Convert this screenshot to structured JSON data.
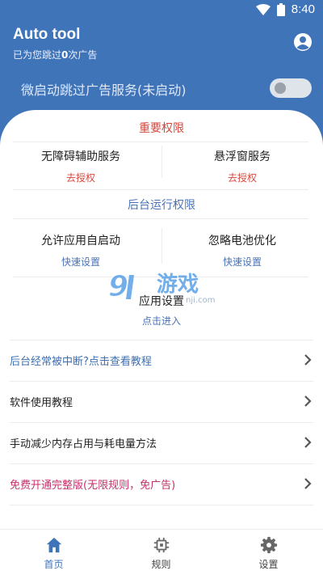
{
  "status_bar": {
    "time": "8:40",
    "icons": [
      "wifi-icon",
      "battery-icon"
    ]
  },
  "header": {
    "title": "Auto tool",
    "subtitle_prefix": "已为您跳过",
    "skip_count": "0",
    "subtitle_suffix": "次广告",
    "account_icon": "account-circle-icon"
  },
  "service": {
    "label": "微启动跳过广告服务(未启动)",
    "enabled": false
  },
  "important_permissions": {
    "title": "重要权限",
    "items": [
      {
        "title": "无障碍辅助服务",
        "action": "去授权"
      },
      {
        "title": "悬浮窗服务",
        "action": "去授权"
      }
    ]
  },
  "background_permissions": {
    "title": "后台运行权限",
    "items": [
      {
        "title": "允许应用自启动",
        "action": "快速设置"
      },
      {
        "title": "忽略电池优化",
        "action": "快速设置"
      }
    ]
  },
  "app_settings": {
    "title": "应用设置",
    "action": "点击进入"
  },
  "watermark": {
    "number": "9",
    "text": "游戏",
    "domain": "nji.com"
  },
  "list": [
    {
      "label": "后台经常被中断?点击查看教程",
      "color": "#3f6fb0"
    },
    {
      "label": "软件使用教程",
      "color": "#222222"
    },
    {
      "label": "手动减少内存占用与耗电量方法",
      "color": "#222222"
    },
    {
      "label": "免费开通完整版(无限规则，免广告)",
      "color": "#c6306b"
    }
  ],
  "bottom_nav": [
    {
      "label": "首页",
      "icon": "home-icon",
      "active": true
    },
    {
      "label": "规则",
      "icon": "chip-icon",
      "active": false
    },
    {
      "label": "设置",
      "icon": "gear-icon",
      "active": false
    }
  ],
  "colors": {
    "primary": "#3f74b8",
    "accent_red": "#d2463c",
    "accent_blue": "#4a73b7",
    "accent_pink": "#c6306b"
  }
}
